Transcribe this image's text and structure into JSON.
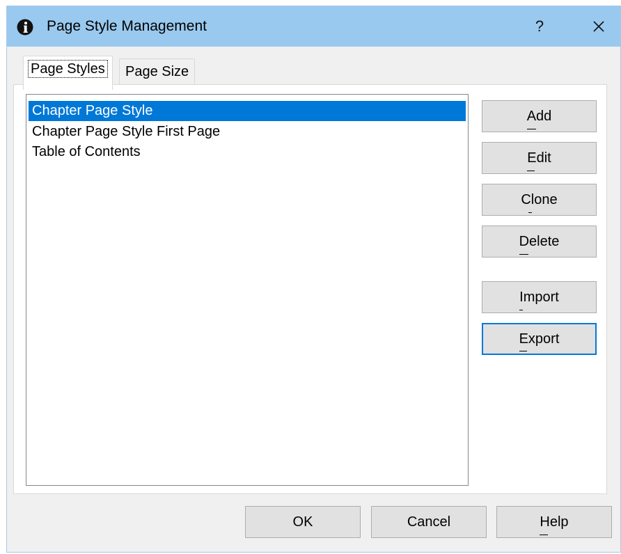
{
  "window": {
    "title": "Page Style Management",
    "help_button": "?",
    "icons": {
      "app": "info-circle-icon",
      "close": "close-icon"
    }
  },
  "tabs": [
    {
      "label": "Page Styles",
      "active": true
    },
    {
      "label": "Page Size",
      "active": false
    }
  ],
  "page_styles_list": {
    "items": [
      {
        "label": "Chapter Page Style",
        "selected": true
      },
      {
        "label": "Chapter Page Style First Page",
        "selected": false
      },
      {
        "label": "Table of Contents",
        "selected": false
      }
    ]
  },
  "side_buttons": {
    "add": "Add",
    "edit": "Edit",
    "clone": "Clone",
    "delete": "Delete",
    "import": "Import",
    "export": "Export"
  },
  "bottom_buttons": {
    "ok": "OK",
    "cancel": "Cancel",
    "help": "Help"
  },
  "colors": {
    "titlebar": "#99c9ef",
    "selection": "#0078d7",
    "focus_border": "#0078d7"
  }
}
